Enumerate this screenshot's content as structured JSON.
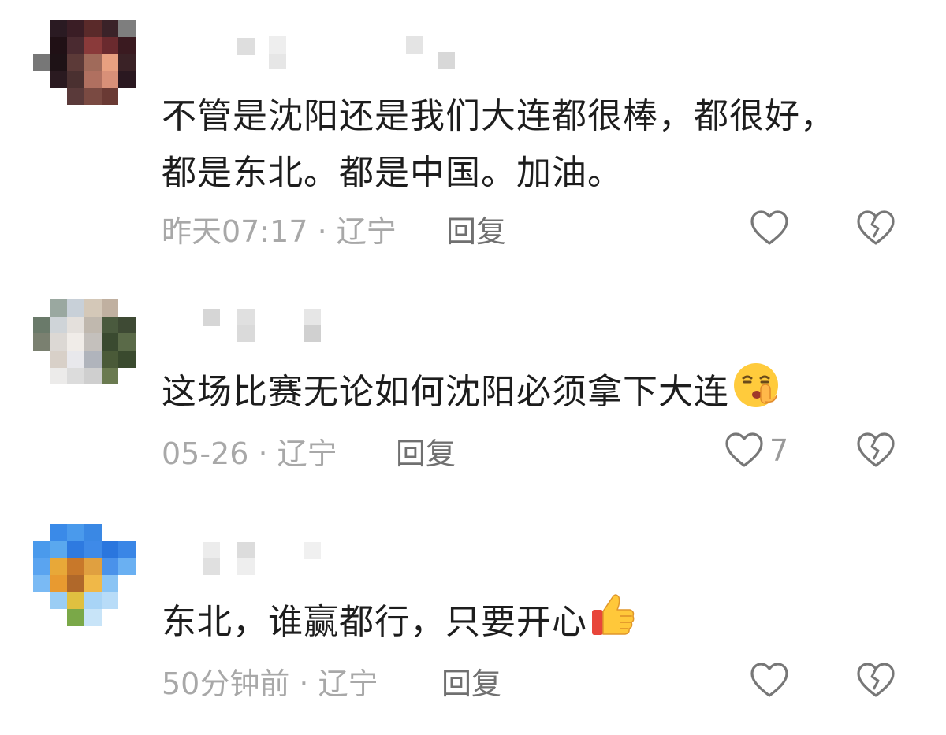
{
  "comments": [
    {
      "text": "不管是沈阳还是我们大连都很棒，都很好，\n都是东北。都是中国。加油。",
      "meta": "昨天07:17 · 辽宁",
      "reply_label": "回复",
      "like_count": "",
      "emoji": ""
    },
    {
      "text": "这场比赛无论如何沈阳必须拿下大连",
      "meta": "05-26 · 辽宁",
      "reply_label": "回复",
      "like_count": "7",
      "emoji": "shushing-face-emoji"
    },
    {
      "text": "东北，谁赢都行，只要开心",
      "meta": "50分钟前 · 辽宁",
      "reply_label": "回复",
      "like_count": "",
      "emoji": "thumbs-up-emoji"
    }
  ],
  "colors": {
    "text": "#1d1d1d",
    "meta": "#a8a8a8",
    "reply": "#707070",
    "icon": "#777777"
  }
}
